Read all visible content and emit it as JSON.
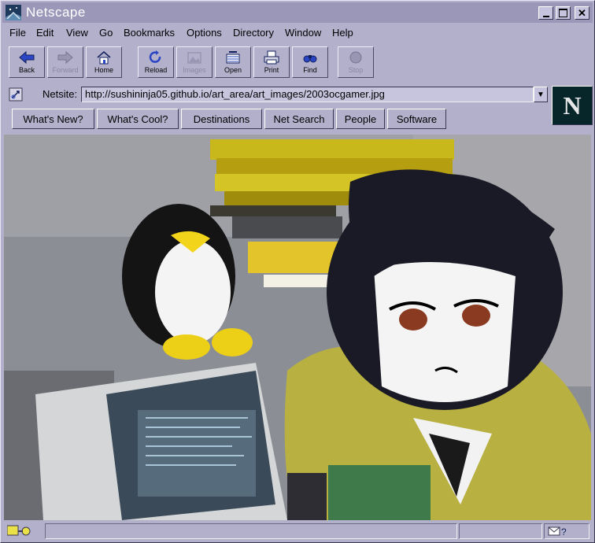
{
  "window": {
    "title": "Netscape"
  },
  "menu": [
    "File",
    "Edit",
    "View",
    "Go",
    "Bookmarks",
    "Options",
    "Directory",
    "Window",
    "Help"
  ],
  "toolbar": [
    {
      "label": "Back",
      "icon": "back-arrow-icon",
      "enabled": true
    },
    {
      "label": "Forward",
      "icon": "forward-arrow-icon",
      "enabled": false
    },
    {
      "label": "Home",
      "icon": "home-icon",
      "enabled": true
    },
    {
      "label": "Reload",
      "icon": "reload-icon",
      "enabled": true
    },
    {
      "label": "Images",
      "icon": "images-icon",
      "enabled": false
    },
    {
      "label": "Open",
      "icon": "open-icon",
      "enabled": true
    },
    {
      "label": "Print",
      "icon": "print-icon",
      "enabled": true
    },
    {
      "label": "Find",
      "icon": "find-icon",
      "enabled": true
    },
    {
      "label": "Stop",
      "icon": "stop-icon",
      "enabled": false
    }
  ],
  "location": {
    "label": "Netsite:",
    "url": "http://sushininja05.github.io/art_area/art_images/2003ocgamer.jpg"
  },
  "logo": {
    "letter": "N"
  },
  "directory_buttons": [
    "What's New?",
    "What's Cool?",
    "Destinations",
    "Net Search",
    "People",
    "Software"
  ],
  "status": {
    "text": ""
  },
  "colors": {
    "chrome": "#b3b0cc",
    "titlebar": "#9a97b9",
    "logo_bg": "#06262a"
  }
}
